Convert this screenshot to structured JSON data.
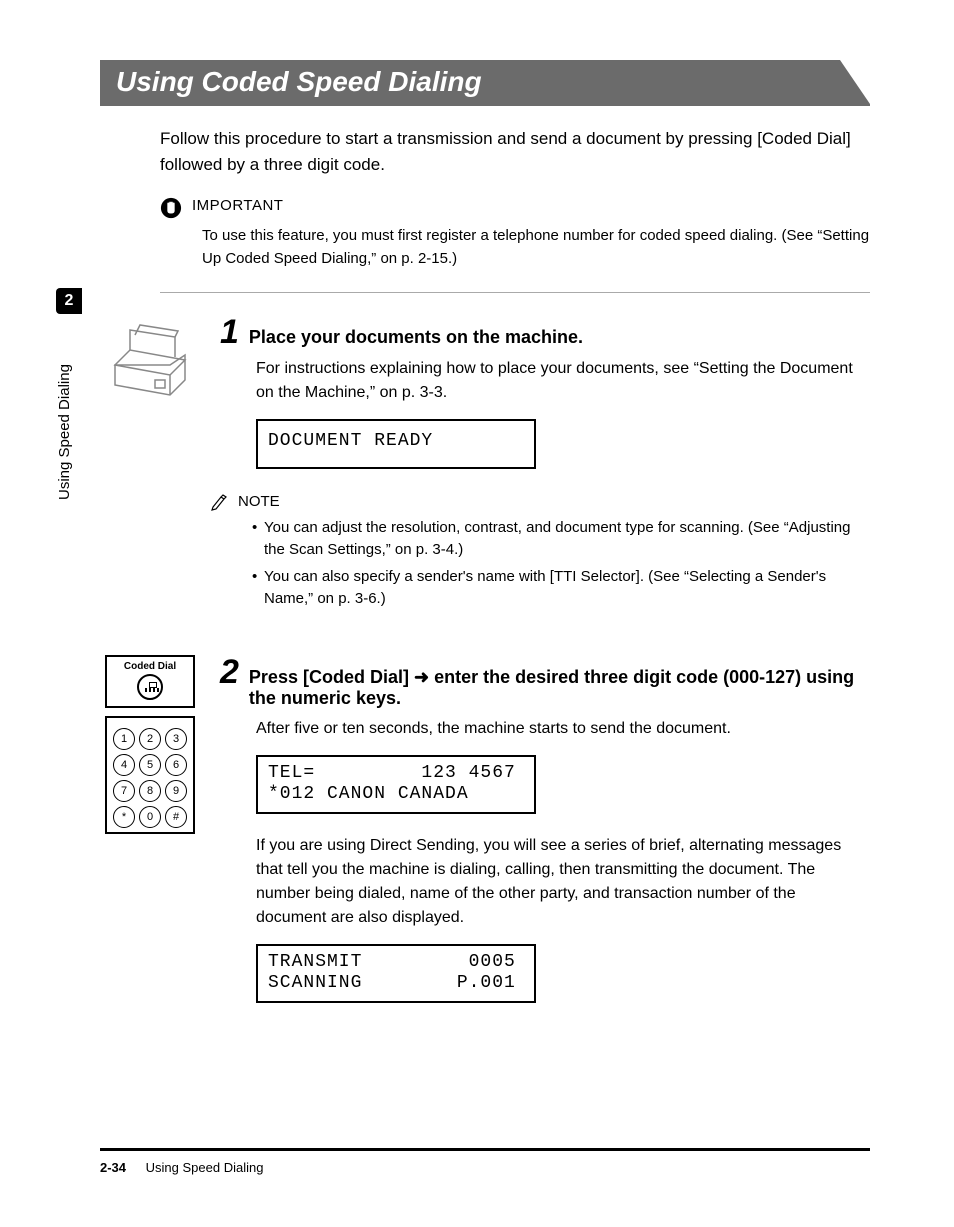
{
  "banner": {
    "title": "Using Coded Speed Dialing"
  },
  "intro": "Follow this procedure to start a transmission and send a document by pressing [Coded Dial] followed by a three digit code.",
  "important": {
    "label": "IMPORTANT",
    "text": "To use this feature, you must first register a telephone number for coded speed dialing. (See “Setting Up Coded Speed Dialing,” on p. 2-15.)"
  },
  "step1": {
    "number": "1",
    "title": "Place your documents on the machine.",
    "body": "For instructions explaining how to place your documents, see “Setting the Document on the Machine,” on p. 3-3.",
    "lcd": "DOCUMENT READY"
  },
  "note": {
    "label": "NOTE",
    "items": [
      "You can adjust the resolution, contrast, and document type for scanning. (See “Adjusting the Scan Settings,” on p. 3-4.)",
      "You can also specify a sender's name with [TTI Selector]. (See “Selecting a Sender's Name,” on p. 3-6.)"
    ]
  },
  "keypad": {
    "label": "Coded Dial",
    "keys": [
      "1",
      "2",
      "3",
      "4",
      "5",
      "6",
      "7",
      "8",
      "9",
      "*",
      "0",
      "#"
    ]
  },
  "step2": {
    "number": "2",
    "title_pre": "Press [Coded Dial] ",
    "arrow": "➜",
    "title_post": " enter the desired three digit code (000-127) using the numeric keys.",
    "body1": "After five or ten seconds, the machine starts to send the document.",
    "lcd1": "TEL=         123 4567\n*012 CANON CANADA",
    "body2": "If you are using Direct Sending, you will see a series of brief, alternating messages that tell you the machine is dialing, calling, then transmitting the document. The number being dialed, name of the other party, and transaction number of the document are also displayed.",
    "lcd2": "TRANSMIT         0005\nSCANNING        P.001"
  },
  "sidebar": {
    "chapter": "2",
    "label": "Using Speed Dialing"
  },
  "footer": {
    "pagenum": "2-34",
    "title": "Using Speed Dialing"
  }
}
